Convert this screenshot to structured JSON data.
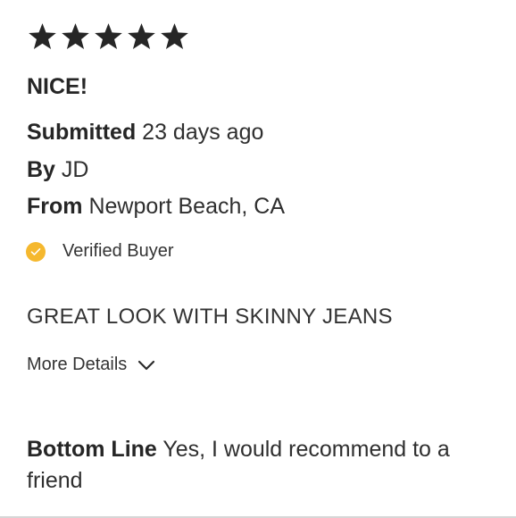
{
  "review": {
    "rating": 5,
    "rating_max": 5,
    "title": "NICE!",
    "submitted_label": "Submitted",
    "submitted_value": "23 days ago",
    "by_label": "By",
    "by_value": "JD",
    "from_label": "From",
    "from_value": "Newport Beach, CA",
    "verified_label": "Verified Buyer",
    "headline": "GREAT LOOK WITH SKINNY JEANS",
    "more_details_label": "More Details",
    "bottom_line_label": "Bottom Line",
    "bottom_line_value": "Yes, I would recommend to a friend"
  },
  "icons": {
    "star": "star-icon",
    "verified": "check-circle-icon",
    "expand": "chevron-down-icon"
  },
  "colors": {
    "star": "#262626",
    "verified_badge": "#f5b82e",
    "text": "#2b2b2b"
  }
}
